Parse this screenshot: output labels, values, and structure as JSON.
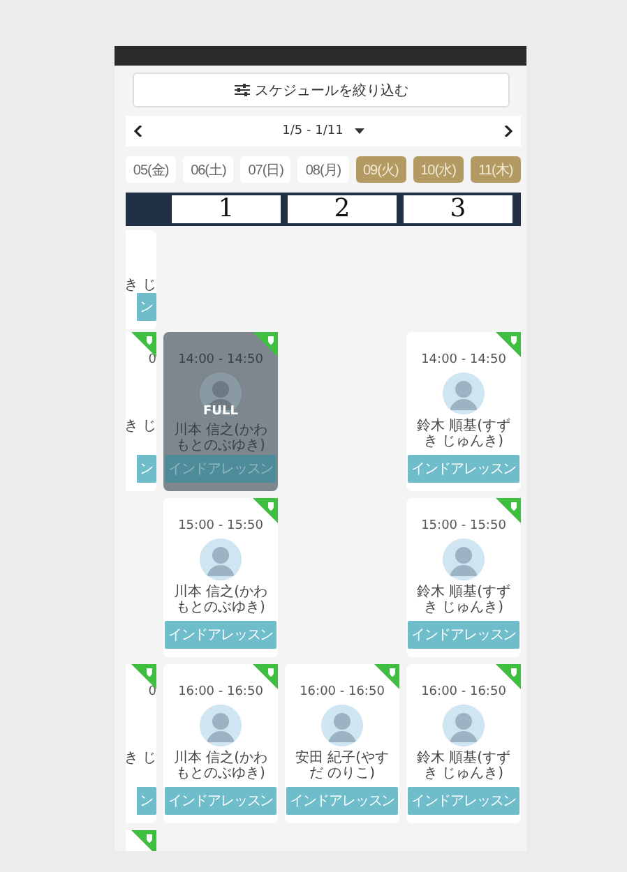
{
  "filter_button": {
    "label": "スケジュールを絞り込む"
  },
  "week_nav": {
    "range": "1/5 - 1/11"
  },
  "dates": [
    {
      "label": "05(金)",
      "selected": false
    },
    {
      "label": "06(土)",
      "selected": false
    },
    {
      "label": "07(日)",
      "selected": false
    },
    {
      "label": "08(月)",
      "selected": false
    },
    {
      "label": "09(火)",
      "selected": true
    },
    {
      "label": "10(水)",
      "selected": true
    },
    {
      "label": "11(木)",
      "selected": true
    }
  ],
  "columns": [
    "1",
    "2",
    "3"
  ],
  "rows": [
    {
      "cells": [
        {
          "kind": "partial",
          "name": "き じ",
          "button": "ン",
          "badge": false
        },
        {
          "kind": "empty"
        },
        {
          "kind": "empty"
        },
        {
          "kind": "empty"
        }
      ]
    },
    {
      "cells": [
        {
          "kind": "partial",
          "time": "0",
          "name": "き じ",
          "button": "ン",
          "badge": true
        },
        {
          "kind": "lesson",
          "time": "14:00 - 14:50",
          "name": "川本 信之(かわもとのぶゆき)",
          "button": "インドアレッスン",
          "full": true,
          "status": "FULL",
          "badge": true
        },
        {
          "kind": "empty"
        },
        {
          "kind": "lesson",
          "time": "14:00 - 14:50",
          "name": "鈴木 順基(すずき じゅんき)",
          "button": "インドアレッスン",
          "full": false,
          "badge": true
        }
      ]
    },
    {
      "cells": [
        {
          "kind": "empty"
        },
        {
          "kind": "lesson",
          "time": "15:00 - 15:50",
          "name": "川本 信之(かわもとのぶゆき)",
          "button": "インドアレッスン",
          "full": false,
          "badge": true
        },
        {
          "kind": "empty"
        },
        {
          "kind": "lesson",
          "time": "15:00 - 15:50",
          "name": "鈴木 順基(すずき じゅんき)",
          "button": "インドアレッスン",
          "full": false,
          "badge": true
        }
      ]
    },
    {
      "cells": [
        {
          "kind": "partial",
          "time": "0",
          "name": "き じ",
          "button": "ン",
          "badge": true
        },
        {
          "kind": "lesson",
          "time": "16:00 - 16:50",
          "name": "川本 信之(かわもとのぶゆき)",
          "button": "インドアレッスン",
          "full": false,
          "badge": true
        },
        {
          "kind": "lesson",
          "time": "16:00 - 16:50",
          "name": "安田 紀子(やすだ のりこ)",
          "button": "インドアレッスン",
          "full": false,
          "badge": true
        },
        {
          "kind": "lesson",
          "time": "16:00 - 16:50",
          "name": "鈴木 順基(すずき じゅんき)",
          "button": "インドアレッスン",
          "full": false,
          "badge": true
        }
      ]
    },
    {
      "cells": [
        {
          "kind": "stub",
          "badge": true
        }
      ]
    }
  ]
}
